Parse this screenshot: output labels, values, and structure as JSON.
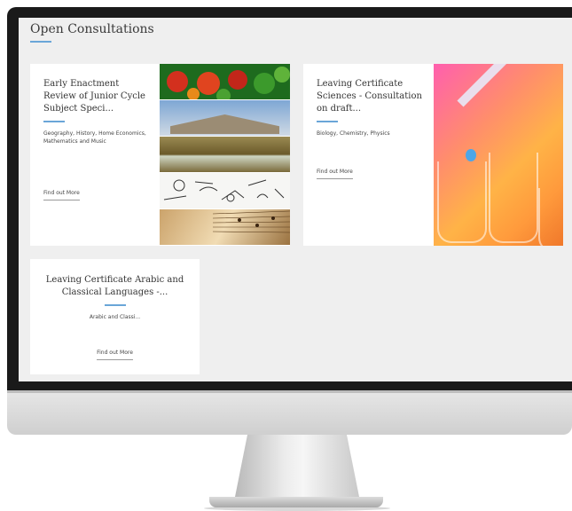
{
  "page": {
    "title": "Open Consultations"
  },
  "cards": [
    {
      "title": "Early Enactment Review of Junior Cycle Subject Speci...",
      "subjects": "Geography, History, Home Economics, Mathematics and Music",
      "link": "Find out More"
    },
    {
      "title": "Leaving Certificate Sciences - Consultation on draft...",
      "subjects": "Biology, Chemistry, Physics",
      "link": "Find out More"
    },
    {
      "title": "Leaving Certificate Arabic and Classical Languages -...",
      "subjects": "Arabic and Classi...",
      "link": "Find out More"
    }
  ],
  "colors": {
    "accent_rule": "#6aa6d8",
    "screen_bg": "#efefef"
  }
}
